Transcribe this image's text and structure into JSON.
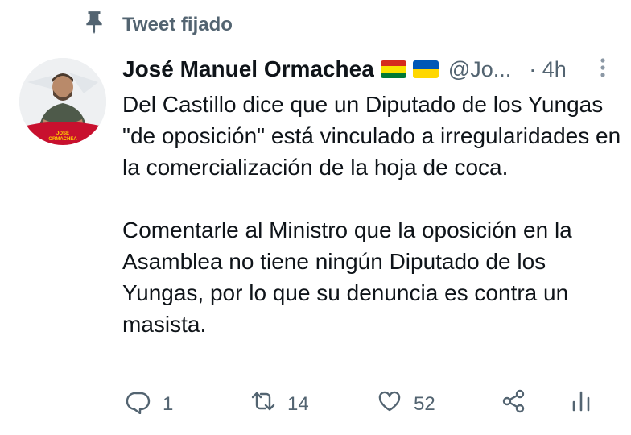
{
  "pinned": {
    "label": "Tweet fijado",
    "icon": "pin-icon"
  },
  "tweet": {
    "author_name": "José Manuel Ormachea",
    "flags": [
      "bolivia-flag-icon",
      "ukraine-flag-icon"
    ],
    "handle": "@Jo...",
    "time": "· 4h",
    "paragraph_1": "Del Castillo dice que un Diputado de los Yungas \"de oposición\" está vinculado a irregularidades en la comercialización de la hoja de coca.",
    "paragraph_2": "Comentarle al Ministro que la oposición en la Asamblea no tiene ningún Diputado de los Yungas, por lo que su denuncia es contra un masista."
  },
  "avatar": {
    "text_1": "JOSÉ",
    "text_2": "ORMACHEA"
  },
  "actions": {
    "replies": "1",
    "retweets": "14",
    "likes": "52"
  },
  "colors": {
    "muted": "#536471",
    "text": "#0f1419"
  }
}
